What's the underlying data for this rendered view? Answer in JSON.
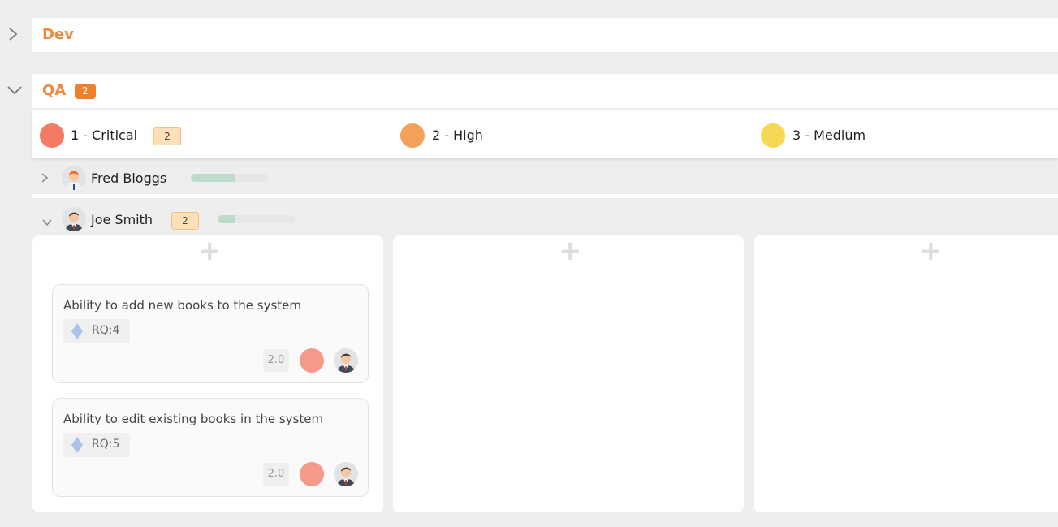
{
  "groups": {
    "dev": {
      "title": "Dev",
      "collapsed_icon": "chevron-right-icon"
    },
    "qa": {
      "title": "QA",
      "count": "2",
      "expanded_icon": "chevron-down-icon"
    }
  },
  "priorities": [
    {
      "label": "1 - Critical",
      "count": "2",
      "color": "#f47a63"
    },
    {
      "label": "2 - High",
      "count": "",
      "color": "#f3a05a"
    },
    {
      "label": "3 - Medium",
      "count": "",
      "color": "#f5d955"
    }
  ],
  "users": [
    {
      "name": "Fred Bloggs",
      "count": "",
      "progress": 0.57,
      "expanded": false
    },
    {
      "name": "Joe Smith",
      "count": "2",
      "progress": 0.23,
      "expanded": true
    }
  ],
  "add_icon": "plus-icon",
  "cards": [
    {
      "title": "Ability to add new books to the system",
      "req": "RQ:4",
      "estimate": "2.0",
      "priority_color": "#f59a88"
    },
    {
      "title": "Ability to edit existing books in the system",
      "req": "RQ:5",
      "estimate": "2.0",
      "priority_color": "#f59a88"
    }
  ],
  "colors": {
    "accent": "#f0873a",
    "badge": "#ef7f2c",
    "progress_fill": "#bcdcc9",
    "requirement_icon": "#a9c3ea"
  }
}
